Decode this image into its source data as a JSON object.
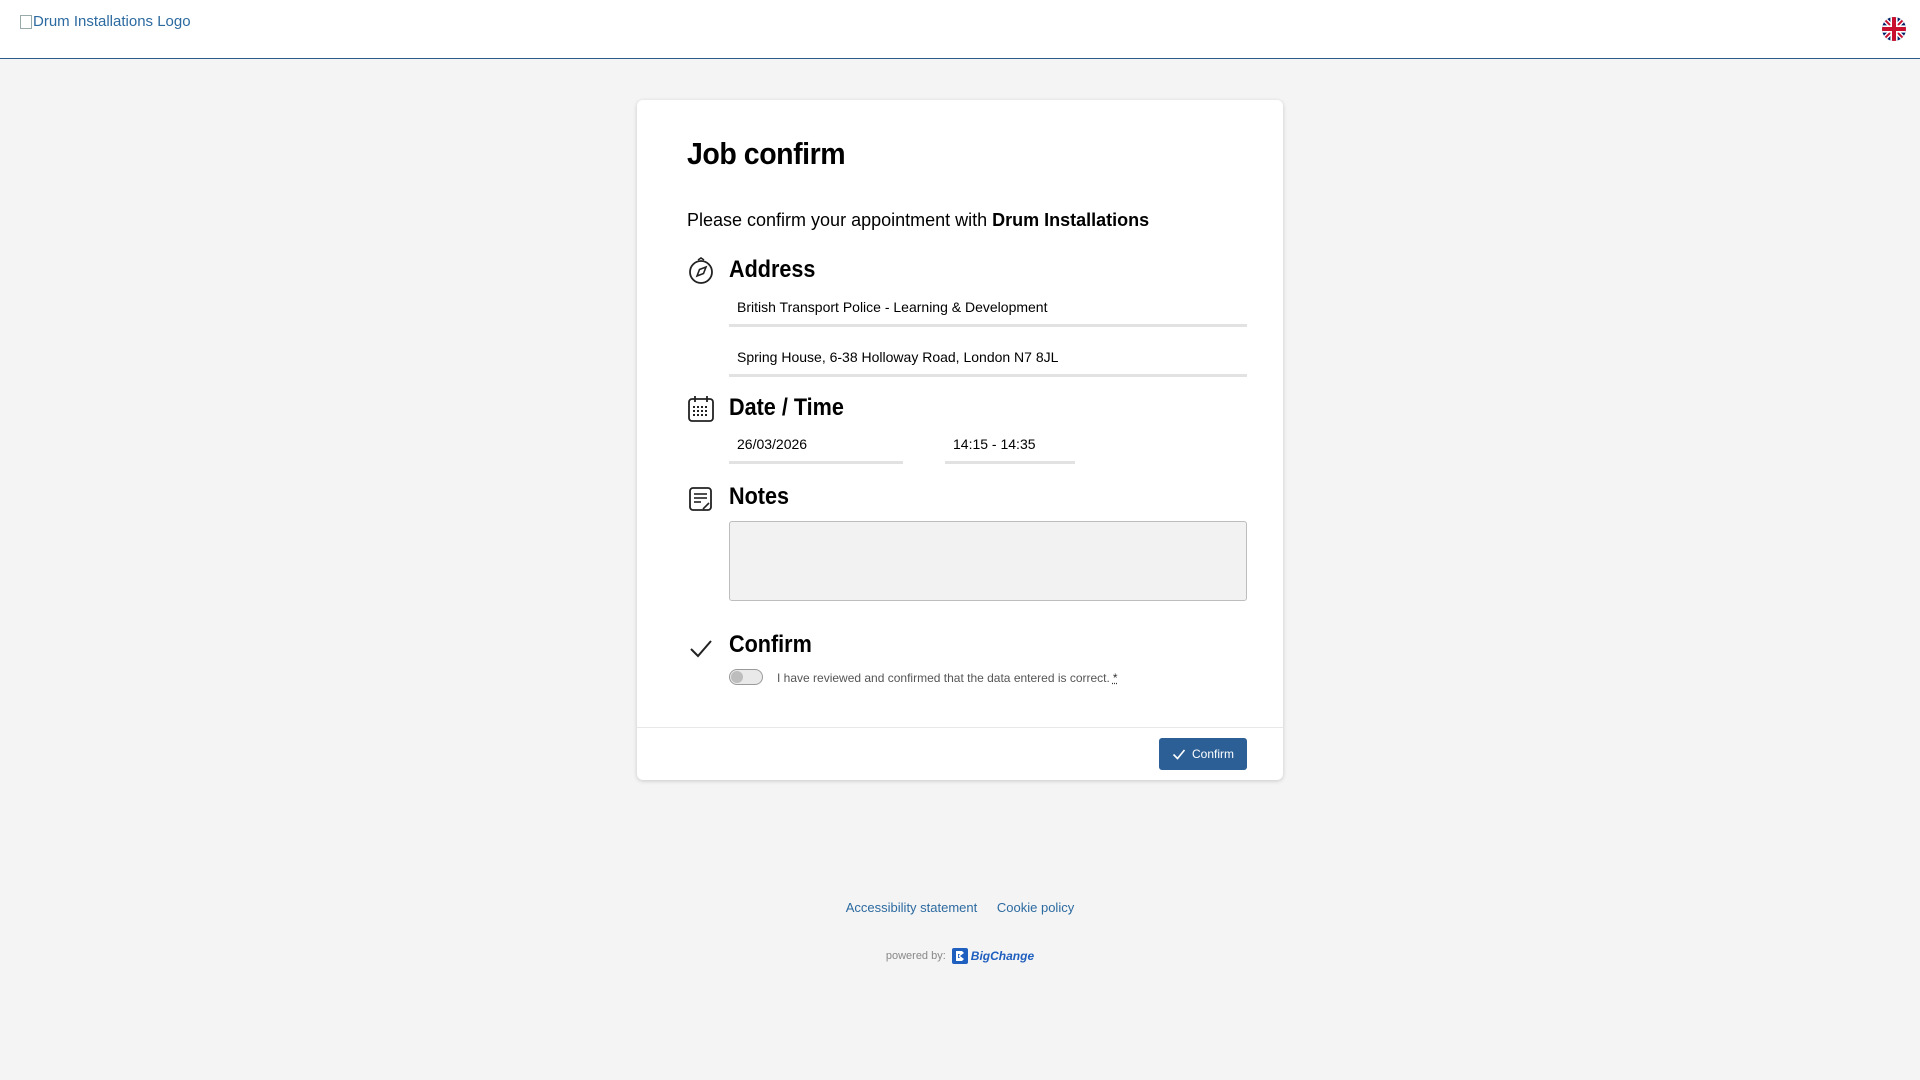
{
  "header": {
    "logo_alt": "Drum Installations Logo",
    "language_icon": "uk-flag-icon"
  },
  "card": {
    "title": "Job confirm",
    "intro_prefix": "Please confirm your appointment with ",
    "company": "Drum Installations",
    "address": {
      "title": "Address",
      "icon": "compass-icon",
      "line1": "British Transport Police - Learning & Development",
      "line2": "Spring House, 6-38 Holloway Road, London N7 8JL"
    },
    "datetime": {
      "title": "Date / Time",
      "icon": "calendar-icon",
      "date": "26/03/2026",
      "time": "14:15 - 14:35"
    },
    "notes": {
      "title": "Notes",
      "icon": "notes-icon",
      "value": ""
    },
    "confirm": {
      "title": "Confirm",
      "icon": "checkmark-icon",
      "checkbox_label": "I have reviewed and confirmed that the data entered is correct.",
      "required_marker": "*",
      "checked": false
    },
    "button_label": "Confirm"
  },
  "footer": {
    "links": [
      "Accessibility statement",
      "Cookie policy"
    ],
    "powered_by": "powered by:",
    "brand": "BigChange"
  },
  "colors": {
    "primary": "#2c5f96",
    "link": "#2c6aa0",
    "background": "#f4f4f4"
  }
}
